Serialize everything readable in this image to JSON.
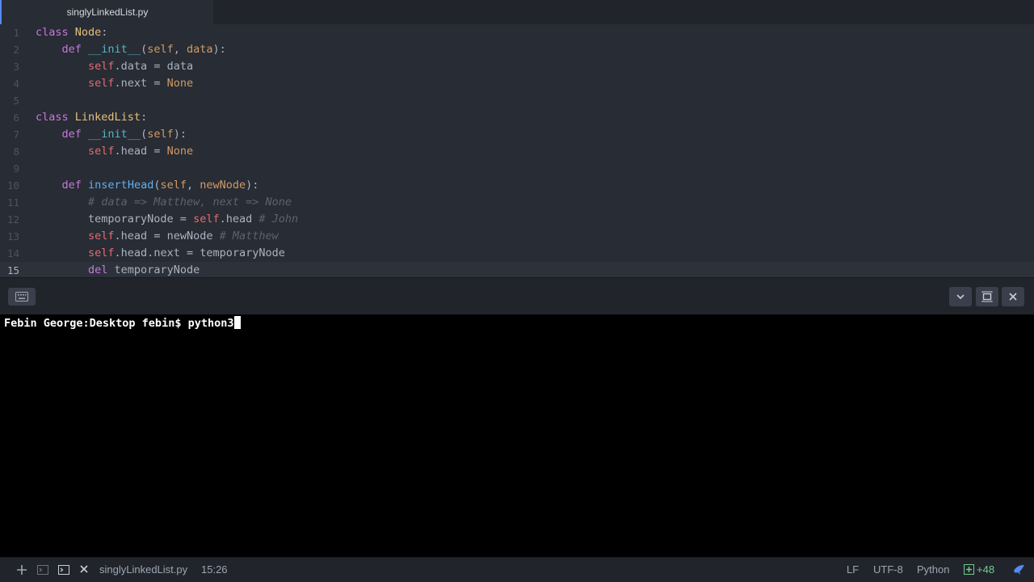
{
  "tab": {
    "title": "singlyLinkedList.py"
  },
  "editor": {
    "lines": [
      {
        "num": "1",
        "tokens": [
          [
            "kw",
            "class"
          ],
          [
            "",
            " "
          ],
          [
            "cls",
            "Node"
          ],
          [
            "",
            ":"
          ]
        ]
      },
      {
        "num": "2",
        "tokens": [
          [
            "",
            "    "
          ],
          [
            "kw",
            "def"
          ],
          [
            "",
            " "
          ],
          [
            "dunder",
            "__init__"
          ],
          [
            "",
            "("
          ],
          [
            "param",
            "self"
          ],
          [
            "",
            ", "
          ],
          [
            "param",
            "data"
          ],
          [
            "",
            "):"
          ]
        ]
      },
      {
        "num": "3",
        "tokens": [
          [
            "",
            "        "
          ],
          [
            "self",
            "self"
          ],
          [
            "",
            ".data = data"
          ]
        ]
      },
      {
        "num": "4",
        "tokens": [
          [
            "",
            "        "
          ],
          [
            "self",
            "self"
          ],
          [
            "",
            ".next = "
          ],
          [
            "const",
            "None"
          ]
        ]
      },
      {
        "num": "5",
        "tokens": []
      },
      {
        "num": "6",
        "tokens": [
          [
            "kw",
            "class"
          ],
          [
            "",
            " "
          ],
          [
            "cls",
            "LinkedList"
          ],
          [
            "",
            ":"
          ]
        ]
      },
      {
        "num": "7",
        "tokens": [
          [
            "",
            "    "
          ],
          [
            "kw",
            "def"
          ],
          [
            "",
            " "
          ],
          [
            "dunder",
            "__init__"
          ],
          [
            "",
            "("
          ],
          [
            "param",
            "self"
          ],
          [
            "",
            "):"
          ]
        ]
      },
      {
        "num": "8",
        "tokens": [
          [
            "",
            "        "
          ],
          [
            "self",
            "self"
          ],
          [
            "",
            ".head = "
          ],
          [
            "const",
            "None"
          ]
        ]
      },
      {
        "num": "9",
        "tokens": []
      },
      {
        "num": "10",
        "tokens": [
          [
            "",
            "    "
          ],
          [
            "kw",
            "def"
          ],
          [
            "",
            " "
          ],
          [
            "fn",
            "insertHead"
          ],
          [
            "",
            "("
          ],
          [
            "param",
            "self"
          ],
          [
            "",
            ", "
          ],
          [
            "param",
            "newNode"
          ],
          [
            "",
            "):"
          ]
        ]
      },
      {
        "num": "11",
        "tokens": [
          [
            "",
            "        "
          ],
          [
            "cm",
            "# data => Matthew, next => None"
          ]
        ]
      },
      {
        "num": "12",
        "tokens": [
          [
            "",
            "        temporaryNode = "
          ],
          [
            "self",
            "self"
          ],
          [
            "",
            ".head "
          ],
          [
            "cm",
            "# John"
          ]
        ]
      },
      {
        "num": "13",
        "tokens": [
          [
            "",
            "        "
          ],
          [
            "self",
            "self"
          ],
          [
            "",
            ".head = newNode "
          ],
          [
            "cm",
            "# Matthew"
          ]
        ]
      },
      {
        "num": "14",
        "tokens": [
          [
            "",
            "        "
          ],
          [
            "self",
            "self"
          ],
          [
            "",
            ".head.next = temporaryNode"
          ]
        ]
      },
      {
        "num": "15",
        "tokens": [
          [
            "",
            "        "
          ],
          [
            "kw",
            "del"
          ],
          [
            "",
            " temporaryNode"
          ]
        ]
      }
    ],
    "cursor_line": "15"
  },
  "terminal": {
    "prompt": "Febin George:Desktop febin$ python3"
  },
  "statusbar": {
    "file": "singlyLinkedList.py",
    "cursor": "15:26",
    "line_ending": "LF",
    "encoding": "UTF-8",
    "grammar": "Python",
    "git_added": "+48"
  },
  "icons": {
    "keyboard": "keyboard-icon",
    "chevron": "chevron-down-icon",
    "maximize": "maximize-icon",
    "close": "close-icon",
    "add": "plus-icon",
    "terminal": "terminal-icon",
    "squirrel": "bird-icon"
  },
  "colors": {
    "editor_bg": "#282c34",
    "panel_bg": "#21252b",
    "terminal_bg": "#000000",
    "accent": "#568af2",
    "git_green": "#73c990"
  }
}
